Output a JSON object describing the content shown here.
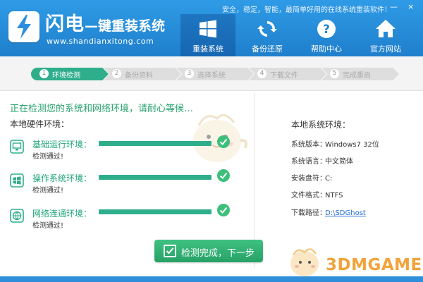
{
  "header": {
    "tagline": "安全，稳定，智能，最简单好用的在线系统重装软件！",
    "title_main": "闪电",
    "title_rest": "—键重装系统",
    "url": "www.shandianxitong.com",
    "nav": [
      {
        "label": "重装系统",
        "icon": "windows-icon",
        "active": true
      },
      {
        "label": "备份还原",
        "icon": "refresh-icon",
        "active": false
      },
      {
        "label": "帮助中心",
        "icon": "help-icon",
        "active": false
      },
      {
        "label": "官方网站",
        "icon": "home-icon",
        "active": false
      }
    ],
    "window_controls": [
      "—",
      "×"
    ],
    "colors": {
      "header": "#1f7fcc",
      "accent_green": "#2fae8c"
    }
  },
  "steps": [
    {
      "num": "1",
      "label": "环境检测",
      "active": true
    },
    {
      "num": "2",
      "label": "备份资料",
      "active": false
    },
    {
      "num": "3",
      "label": "选择系统",
      "active": false
    },
    {
      "num": "4",
      "label": "下载文件",
      "active": false
    },
    {
      "num": "5",
      "label": "完成重启",
      "active": false
    }
  ],
  "detect": {
    "status": "正在检测您的系统和网络环境，请耐心等候…",
    "hardware_title": "本地硬件环境：",
    "items": [
      {
        "label": "基础运行环境：",
        "result": "检测通过!",
        "icon": "monitor-icon",
        "progress": 1.0
      },
      {
        "label": "操作系统环境：",
        "result": "检测通过!",
        "icon": "windows-icon",
        "progress": 1.0
      },
      {
        "label": "网络连通环境：",
        "result": "检测通过!",
        "icon": "globe-icon",
        "progress": 1.0
      }
    ],
    "next_button": "检测完成，下一步"
  },
  "system": {
    "title": "本地系统环境：",
    "rows": [
      {
        "key": "系统版本：",
        "value": "Windows7  32位"
      },
      {
        "key": "系统语言：",
        "value": "中文简体"
      },
      {
        "key": "安装盘符：",
        "value": "C:"
      },
      {
        "key": "文件格式：",
        "value": "NTFS"
      },
      {
        "key": "下载路径：",
        "value": "D:\\SDGhost"
      }
    ]
  },
  "watermark": {
    "text": "3DMGAME"
  }
}
